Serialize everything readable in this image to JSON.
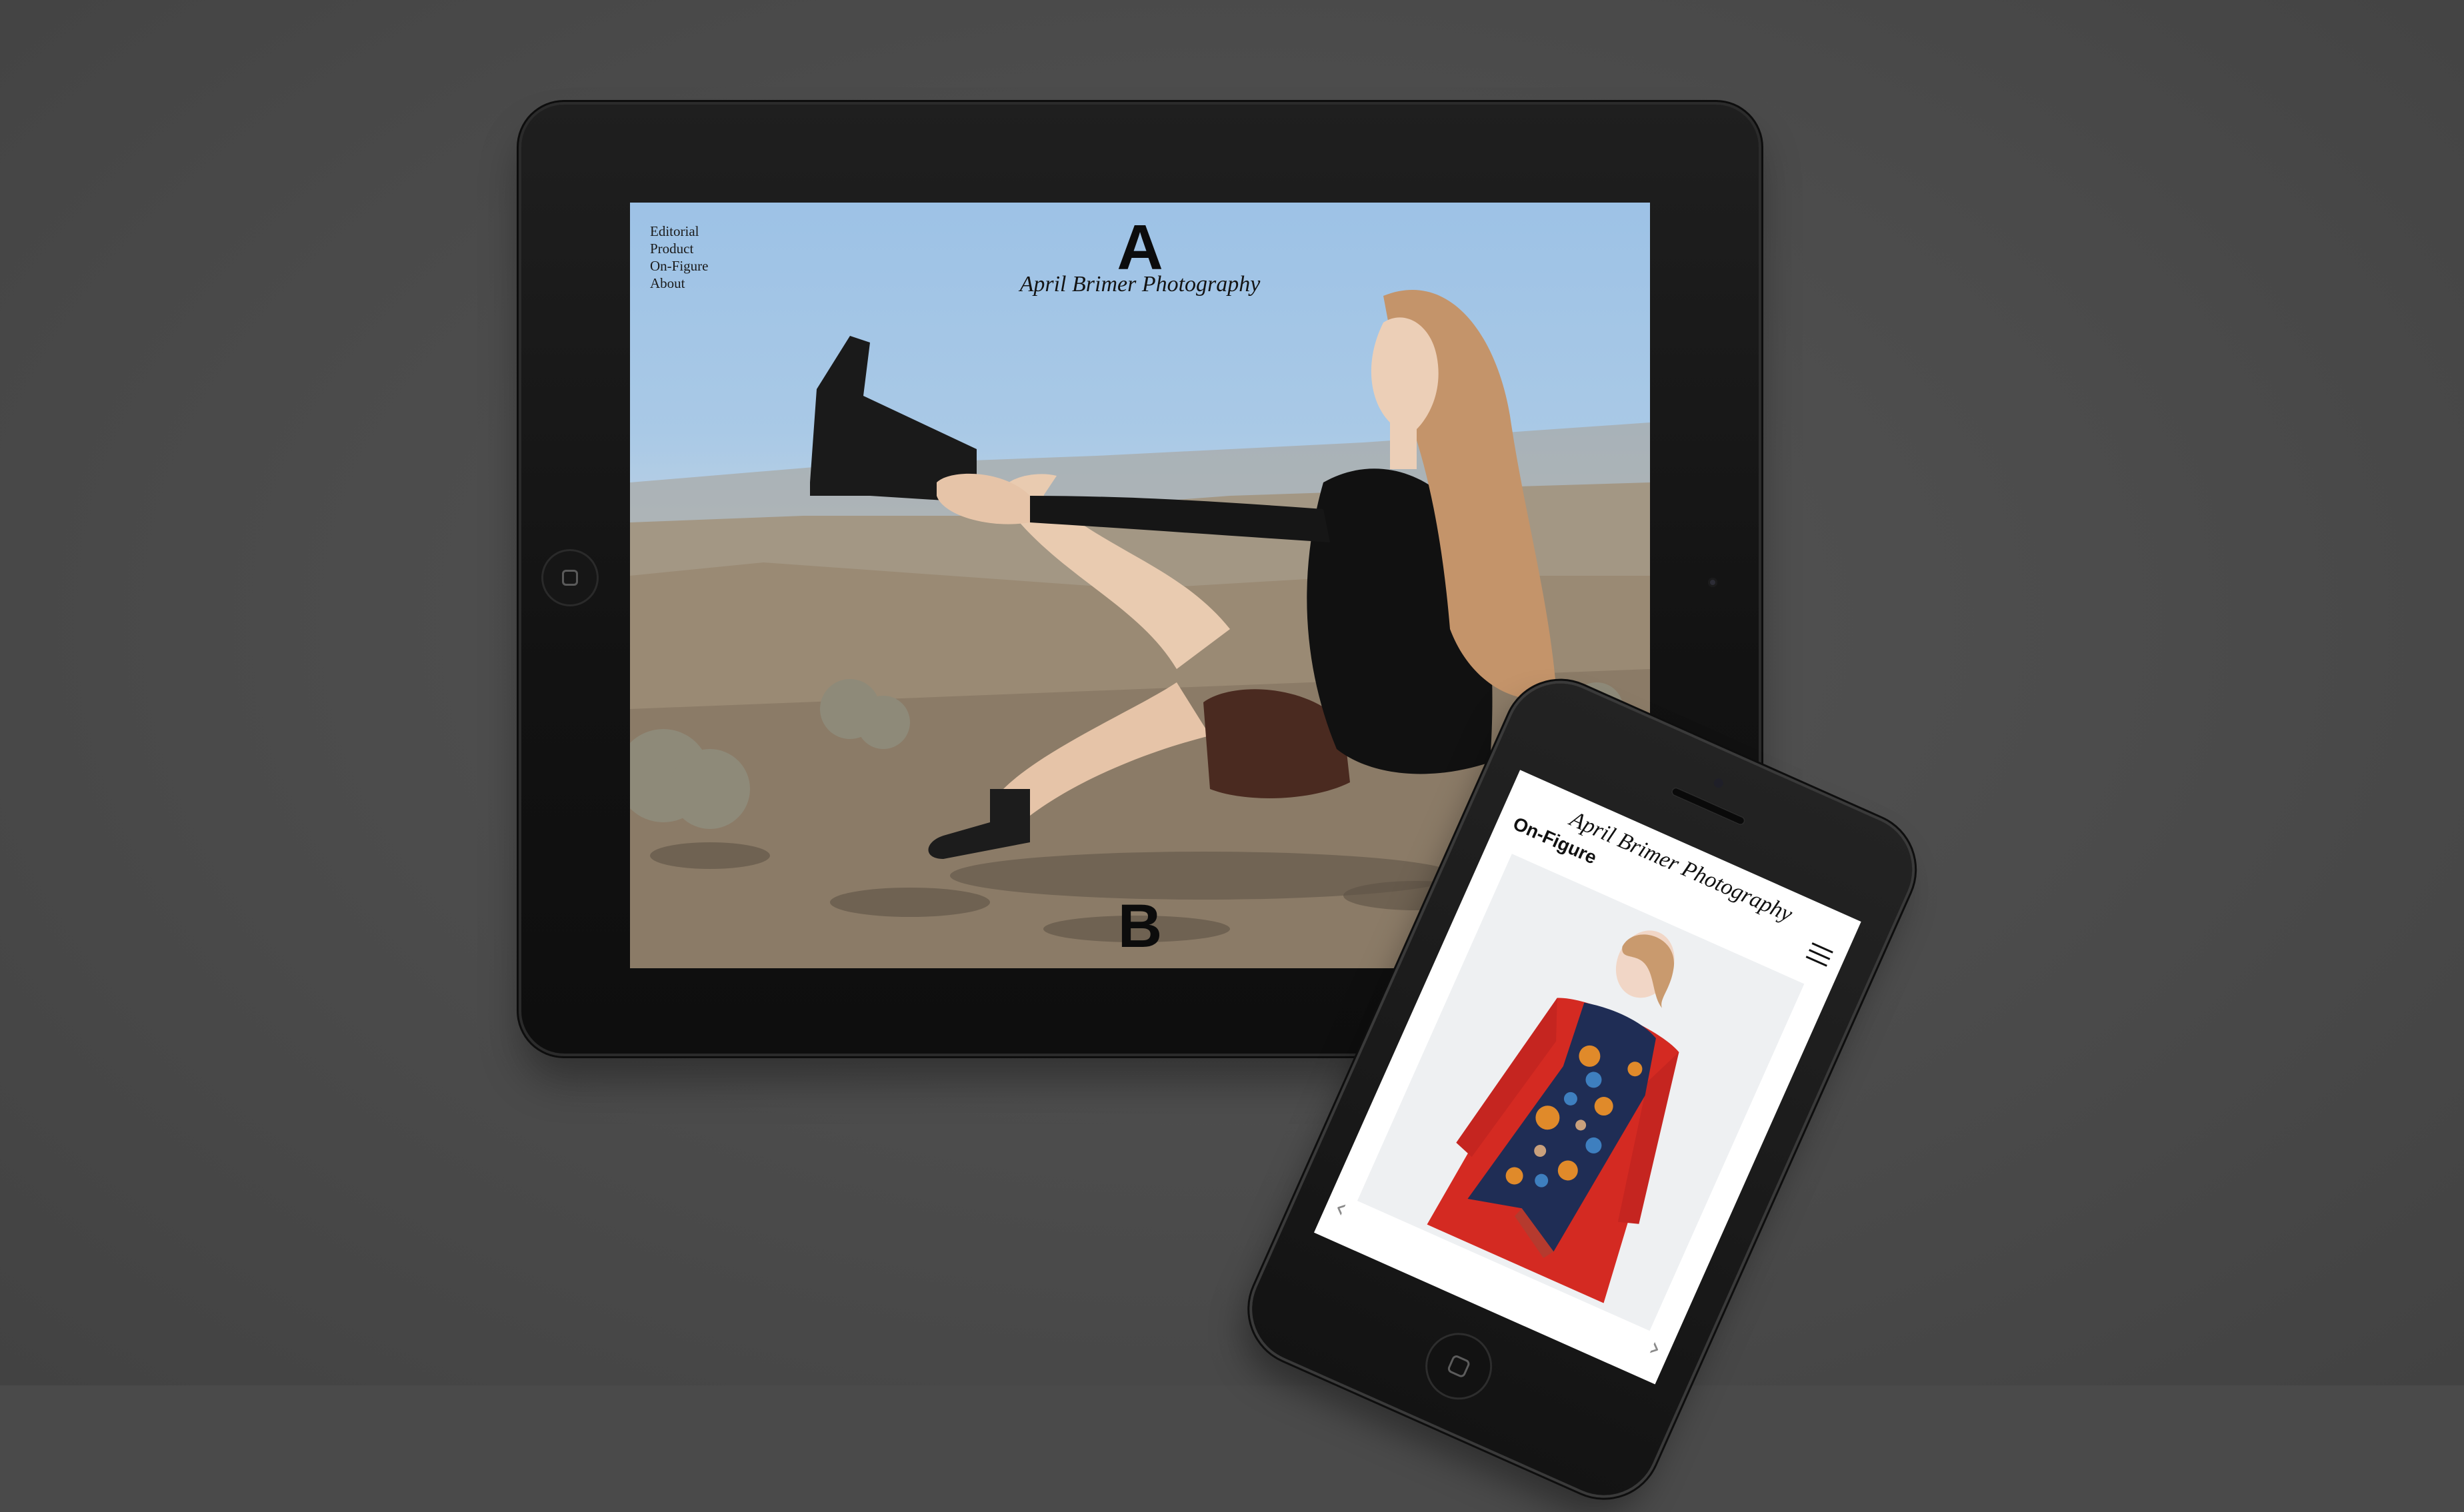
{
  "tablet": {
    "nav": [
      "Editorial",
      "Product",
      "On-Figure",
      "About"
    ],
    "logo_top": "A",
    "title": "April Brimer Photography",
    "logo_bottom": "B"
  },
  "phone": {
    "title": "April Brimer Photography",
    "section": "On-Figure",
    "prev_arrow": "‹",
    "next_arrow": "›"
  },
  "colors": {
    "background": "#4a4a4a",
    "device_frame": "#141414",
    "sky": "#a9c9e6",
    "coat": "#d42a22",
    "scarf": "#1f2d55"
  },
  "icons": [
    "tablet-home-button-icon",
    "menu-icon",
    "phone-home-button-icon"
  ]
}
